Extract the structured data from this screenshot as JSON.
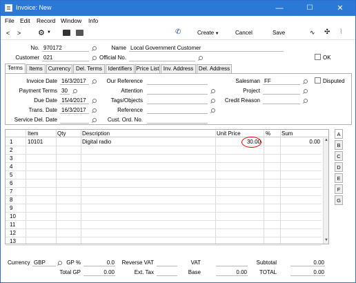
{
  "window": {
    "title": "Invoice: New",
    "minimize": "—",
    "maximize": "☐",
    "close": "✕"
  },
  "menu": [
    "File",
    "Edit",
    "Record",
    "Window",
    "Info"
  ],
  "toolbar": {
    "create": "Create",
    "cancel": "Cancel",
    "save": "Save"
  },
  "header": {
    "no_label": "No.",
    "no_value": "970172",
    "name_label": "Name",
    "name_value": "Local Government Customer",
    "customer_label": "Customer",
    "customer_value": "021",
    "official_label": "Official No.",
    "official_value": "",
    "ok_label": "OK"
  },
  "tabs": [
    "Terms",
    "Items",
    "Currency",
    "Del. Terms",
    "Identifiers",
    "Price List",
    "Inv. Address",
    "Del. Address"
  ],
  "terms": {
    "invoice_date_label": "Invoice Date",
    "invoice_date": "16/3/2017",
    "our_ref_label": "Our Reference",
    "our_ref": "",
    "salesman_label": "Salesman",
    "salesman": "FF",
    "disputed_label": "Disputed",
    "payment_terms_label": "Payment Terms",
    "payment_terms": "30",
    "attention_label": "Attention",
    "attention": "",
    "project_label": "Project",
    "project": "",
    "due_date_label": "Due Date",
    "due_date": "15/4/2017",
    "tags_label": "Tags/Objects",
    "tags": "",
    "credit_reason_label": "Credit Reason",
    "credit_reason": "",
    "trans_date_label": "Trans. Date",
    "trans_date": "16/3/2017",
    "reference_label": "Reference",
    "reference": "",
    "service_del_label": "Service Del. Date",
    "service_del": "",
    "cust_ord_label": "Cust. Ord. No.",
    "cust_ord": ""
  },
  "grid": {
    "columns": [
      "Item",
      "Qty",
      "Description",
      "Unit Price",
      "%",
      "Sum"
    ],
    "rows": [
      {
        "n": "1",
        "item": "10101",
        "qty": "",
        "desc": "Digital radio",
        "price": "30.00",
        "pct": "",
        "sum": "0.00"
      },
      {
        "n": "2"
      },
      {
        "n": "3"
      },
      {
        "n": "4"
      },
      {
        "n": "5"
      },
      {
        "n": "6"
      },
      {
        "n": "7"
      },
      {
        "n": "8"
      },
      {
        "n": "9"
      },
      {
        "n": "10"
      },
      {
        "n": "11"
      },
      {
        "n": "12"
      },
      {
        "n": "13"
      }
    ],
    "side_tabs": [
      "A",
      "B",
      "C",
      "D",
      "E",
      "F",
      "G"
    ]
  },
  "footer": {
    "currency_label": "Currency",
    "currency": "GBP",
    "gp_pct_label": "GP %",
    "gp_pct": "0.0",
    "total_gp_label": "Total GP",
    "total_gp": "0.00",
    "reverse_vat_label": "Reverse VAT",
    "reverse_vat": "",
    "ext_tax_label": "Ext. Tax",
    "ext_tax": "",
    "vat_label": "VAT",
    "vat": "",
    "base_label": "Base",
    "base": "0.00",
    "subtotal_label": "Subtotal",
    "subtotal": "0.00",
    "total_label": "TOTAL",
    "total": "0.00"
  }
}
